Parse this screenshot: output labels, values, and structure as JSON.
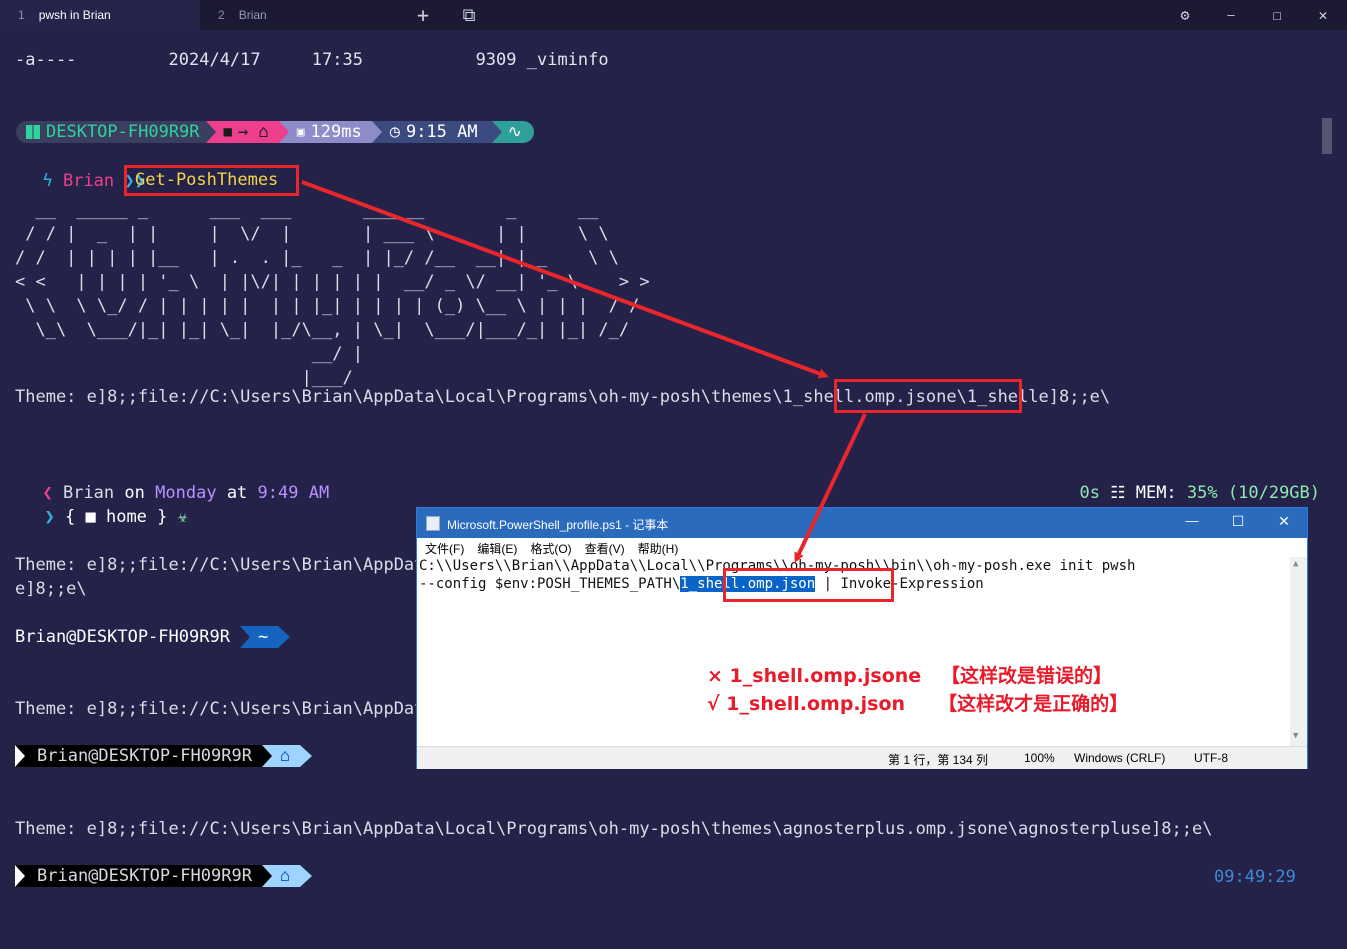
{
  "tabs": [
    {
      "num": "1",
      "label": "pwsh in Brian"
    },
    {
      "num": "2",
      "label": "Brian"
    }
  ],
  "window_controls": {
    "new_tab": "+",
    "dropdown": "⧉",
    "settings": "⚙",
    "minimize": "—",
    "maximize": "☐",
    "close": "✕"
  },
  "terminal": {
    "file_line": "-a----         2024/4/17     17:35           9309 _viminfo",
    "prompt1": {
      "host": "DESKTOP-FH09R9R",
      "path": "→ ⌂",
      "exec_time": "129ms",
      "clock": "9:15 AM"
    },
    "prompt1_user": "Brian",
    "prompt1_chev": "❯❯",
    "command": "Get-PoshThemes",
    "ascii_art": [
      "  __  _____ _      ___  ___       ______        _      __",
      " / / |  _  | |     |  \\/  |       | ___ \\      | |     \\ \\",
      "/ /  | | | | |__   | .  . |_   _  | |_/ /__  __| |__    \\ \\",
      "< <   | | | | '_ \\  | |\\/| | | | | |  __/ _ \\/ __| '_ \\    > >",
      " \\ \\  \\ \\_/ / | | | | |  | | |_| | | | | (_) \\__ \\ | | |  / /",
      "  \\_\\  \\___/|_| |_| \\_|  |_/\\__, | \\_|  \\___/|___/_| |_| /_/",
      "                             __/ |",
      "                            |___/"
    ],
    "theme1_prefix": "Theme: e]8;;file://C:\\Users\\Brian\\AppData\\Local\\Programs\\oh-my-posh\\themes\\",
    "theme1_file": "1_shell.omp.json",
    "theme1_suffix": "e\\1_shelle]8;;e\\",
    "prompt2": {
      "user": "Brian",
      "on": "on",
      "day": "Monday",
      "at": "at",
      "time": "9:49 AM",
      "duration": "0s",
      "mem_label": "MEM:",
      "mem_pct": "35%",
      "mem_detail": "(10/29GB)"
    },
    "prompt2_line2": {
      "open": "{",
      "folder": "home",
      "close": "}"
    },
    "theme2_line1": "Theme: e]8;;file://C:\\Users\\Brian\\AppData\\Local\\Programs\\oh-my-posh\\themes\\agnoster.minimal.omp.json",
    "theme2_line2": "e]8;;e\\",
    "prompt3": {
      "host": "Brian@DESKTOP-FH09R9R",
      "path": "~"
    },
    "theme3_line": "Theme: e]8;;file://C:\\Users\\Brian\\AppData\\Local\\Programs\\oh-my-posh\\themes\\agnoster.omp.json",
    "prompt4": {
      "host": "Brian@DESKTOP-FH09R9R"
    },
    "theme4_line": "Theme: e]8;;file://C:\\Users\\Brian\\AppData\\Local\\Programs\\oh-my-posh\\themes\\agnosterplus.omp.jsone\\agnosterpluse]8;;e\\",
    "prompt5": {
      "host": "Brian@DESKTOP-FH09R9R",
      "clock": "09:49:29"
    }
  },
  "notepad": {
    "title": "Microsoft.PowerShell_profile.ps1 - 记事本",
    "menu": [
      "文件(F)",
      "编辑(E)",
      "格式(O)",
      "查看(V)",
      "帮助(H)"
    ],
    "line1": "C:\\\\Users\\\\Brian\\\\AppData\\\\Local\\\\Programs\\\\oh-my-posh\\\\bin\\\\oh-my-posh.exe init pwsh",
    "line2_prefix": "--config $env:POSH_THEMES_PATH\\",
    "line2_selected": "1_shell.omp.json",
    "line2_suffix": " | Invoke-Expression",
    "status": {
      "position": "第 1 行，第 134 列",
      "zoom": "100%",
      "eol": "Windows (CRLF)",
      "encoding": "UTF-8"
    }
  },
  "annotations": {
    "wrong": "× 1_shell.omp.jsone   【这样改是错误的】",
    "right": "√ 1_shell.omp.json     【这样改才是正确的】"
  },
  "colors": {
    "bg": "#25224a",
    "annot_red": "#e8262b",
    "np_selection": "#0a64c8"
  }
}
